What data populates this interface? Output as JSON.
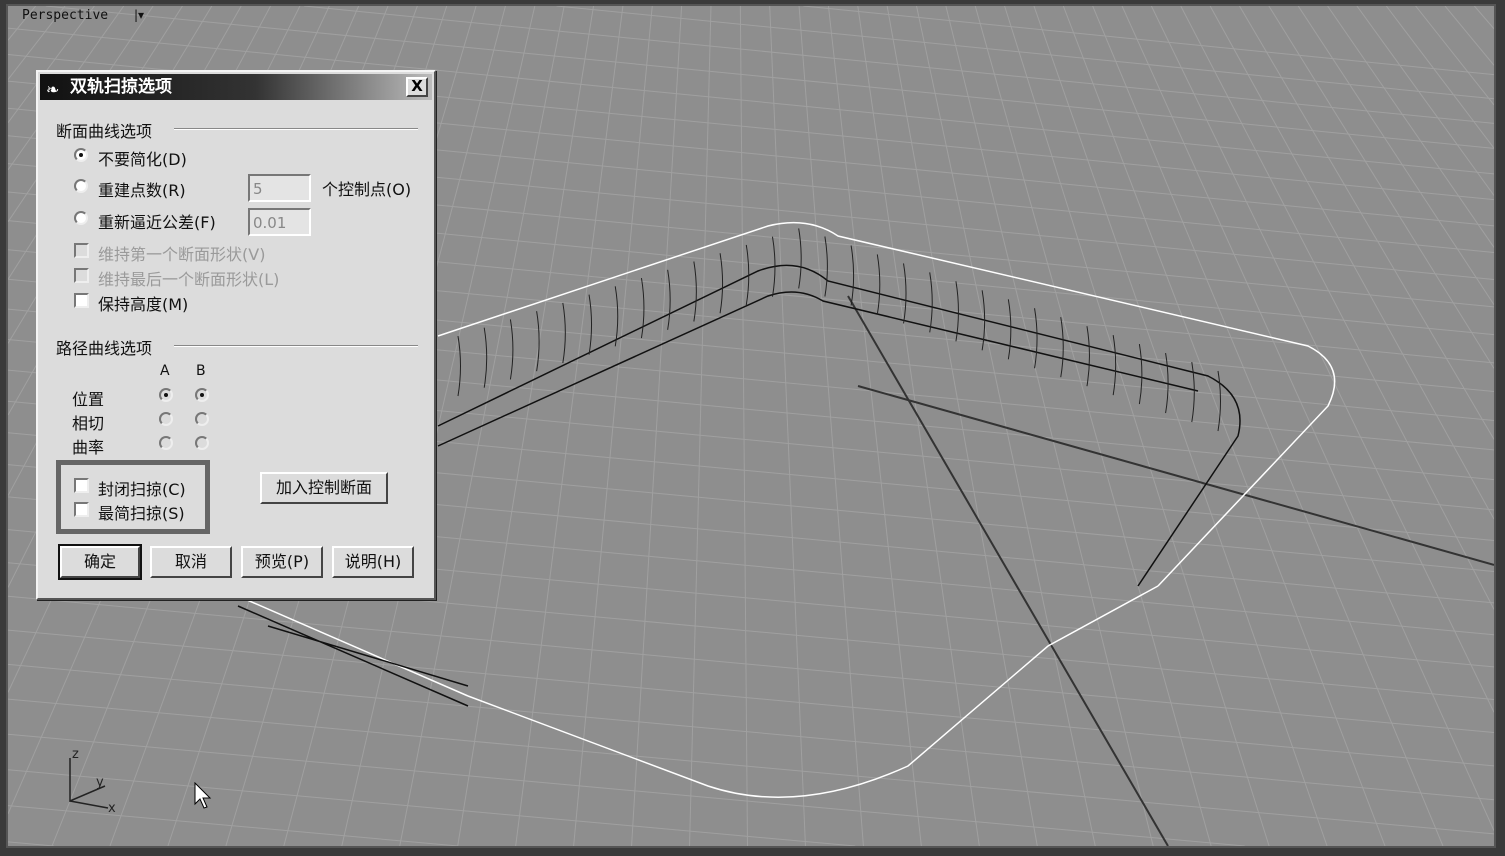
{
  "viewport": {
    "label": "Perspective",
    "menu_icon": "|▾"
  },
  "dialog": {
    "title": "双轨扫掠选项",
    "close_label": "X",
    "section_curve": "断面曲线选项",
    "opt_no_simplify": "不要简化(D)",
    "opt_rebuild": "重建点数(R)",
    "rebuild_value": "5",
    "rebuild_unit": "个控制点(O)",
    "opt_refit": "重新逼近公差(F)",
    "refit_value": "0.01",
    "keep_first": "维持第一个断面形状(V)",
    "keep_last": "维持最后一个断面形状(L)",
    "keep_height": "保持高度(M)",
    "section_rail": "路径曲线选项",
    "col_a": "A",
    "col_b": "B",
    "row_position": "位置",
    "row_tangent": "相切",
    "row_curvature": "曲率",
    "closed_sweep": "封闭扫掠(C)",
    "simple_sweep": "最简扫掠(S)",
    "add_slash": "加入控制断面",
    "ok": "确定",
    "cancel": "取消",
    "preview": "预览(P)",
    "help": "说明(H)"
  },
  "axis": {
    "z": "z",
    "y": "y",
    "x": "x"
  }
}
